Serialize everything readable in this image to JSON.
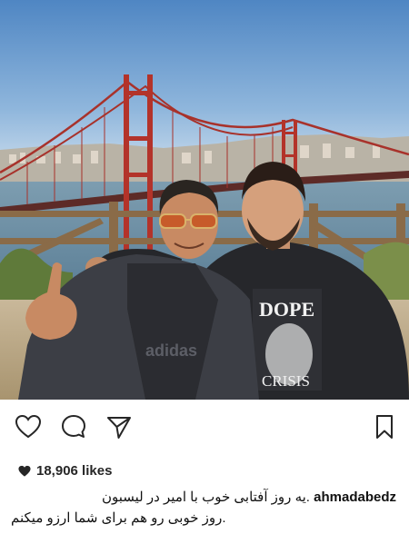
{
  "post": {
    "photo": {
      "alt_icon": "photo-landscape",
      "shirt_text_1": "DOPE",
      "shirt_text_2": "CRISIS",
      "jacket_text": "adidas"
    },
    "actions": {
      "like_icon": "heart-outline-icon",
      "comment_icon": "comment-bubble-icon",
      "share_icon": "paper-plane-icon",
      "save_icon": "bookmark-icon"
    },
    "likes": {
      "count": "18,906 likes"
    },
    "caption": {
      "username": "ahmadabedz",
      "line1": ".یه روز آفتابی خوب با امیر در لیسبون",
      "line2": ".روز خوبی رو هم برای شما ارزو میکنم"
    },
    "colors": {
      "sky_top": "#5a8fc8",
      "sky_bottom": "#c9dcee",
      "bridge_red": "#b3332a",
      "water": "#6f93a8",
      "text": "#262626"
    }
  }
}
